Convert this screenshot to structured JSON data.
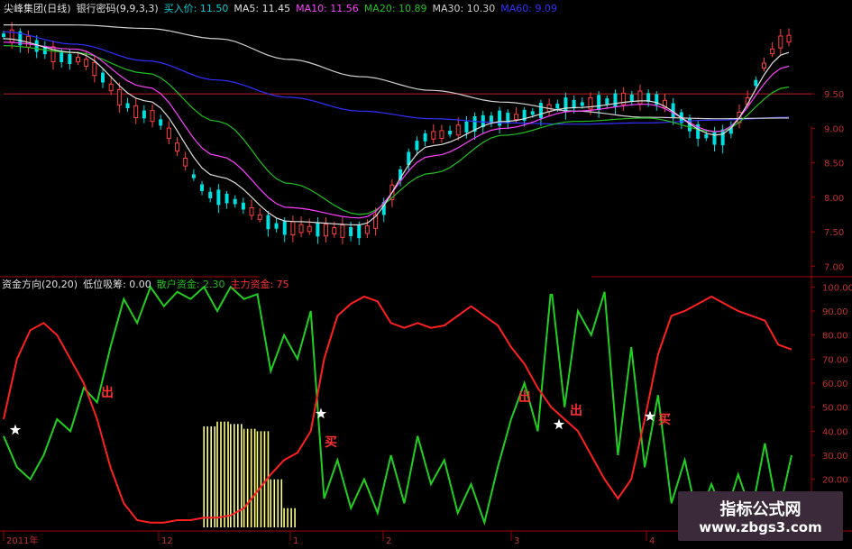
{
  "header_top": {
    "title": "尖峰集团(日线)",
    "indicator": "银行密码(9,9,3,3)",
    "items": [
      {
        "label": "买入价: 11.50",
        "color": "#00d0d0"
      },
      {
        "label": "MA5: 11.45",
        "color": "#e0e0e0"
      },
      {
        "label": "MA10: 11.56",
        "color": "#ff40ff"
      },
      {
        "label": "MA20: 10.89",
        "color": "#20c020"
      },
      {
        "label": "MA30: 10.30",
        "color": "#d0d0d0"
      },
      {
        "label": "MA60: 9.09",
        "color": "#3030ff"
      }
    ]
  },
  "header_bottom": {
    "title": "资金方向(20,20)",
    "items": [
      {
        "label": "低位吸筹: 0.00",
        "color": "#e0e0e0"
      },
      {
        "label": "散户资金: 2.30",
        "color": "#20c020"
      },
      {
        "label": "主力资金: 75",
        "color": "#ff3030"
      }
    ]
  },
  "x_labels": [
    "2011年",
    "12",
    "1",
    "2",
    "3",
    "4"
  ],
  "watermark": {
    "title": "指标公式网",
    "url": "www.zbgs3.com"
  },
  "annotations": [
    "出",
    "买",
    "出",
    "出",
    "买"
  ],
  "chart_data": [
    {
      "type": "line",
      "panel": "price",
      "y_ticks": [
        9.5,
        9.0,
        8.5,
        8.0,
        7.5,
        7.0
      ],
      "ylim": [
        6.9,
        10.6
      ],
      "reference_line": 9.5,
      "n_points": 96,
      "series": [
        {
          "name": "MA60",
          "color": "#3030ff",
          "values": [
            10.4,
            10.22,
            9.98,
            9.7,
            9.45,
            9.25,
            9.14,
            9.08,
            9.06,
            9.08,
            9.12,
            9.16
          ]
        },
        {
          "name": "MA30",
          "color": "#d0d0d0",
          "values": [
            10.5,
            10.5,
            10.45,
            10.3,
            10.0,
            9.75,
            9.55,
            9.38,
            9.25,
            9.16,
            9.14,
            9.15
          ]
        },
        {
          "name": "MA20",
          "color": "#20c020",
          "values": [
            10.2,
            10.1,
            9.8,
            9.1,
            8.2,
            7.75,
            8.35,
            8.9,
            9.1,
            9.15,
            8.95,
            9.6
          ]
        },
        {
          "name": "MA10",
          "color": "#ff40ff",
          "values": [
            10.25,
            10.15,
            9.6,
            8.6,
            7.85,
            7.7,
            8.6,
            9.0,
            9.25,
            9.35,
            8.95,
            9.9
          ]
        },
        {
          "name": "MA5",
          "color": "#e0e0e0",
          "values": [
            10.3,
            10.1,
            9.4,
            8.3,
            7.65,
            7.6,
            8.75,
            9.1,
            9.3,
            9.4,
            8.9,
            10.1
          ]
        },
        {
          "name": "买入价",
          "color": "#00d0d0",
          "values": [
            10.35,
            10.0,
            9.2,
            8.0,
            7.55,
            7.5,
            8.9,
            9.15,
            9.35,
            9.45,
            8.85,
            10.3
          ]
        }
      ]
    },
    {
      "type": "line",
      "panel": "fund",
      "y_ticks": [
        100,
        90,
        80,
        70,
        60,
        50,
        40,
        30,
        20
      ],
      "ylim": [
        0,
        102
      ],
      "series": [
        {
          "name": "主力资金",
          "color": "#ff2020",
          "values": [
            45,
            70,
            82,
            85,
            80,
            70,
            60,
            45,
            25,
            10,
            3,
            2,
            2,
            3,
            3,
            4,
            4,
            5,
            8,
            15,
            22,
            28,
            31,
            40,
            70,
            88,
            93,
            96,
            94,
            85,
            83,
            85,
            83,
            84,
            88,
            92,
            88,
            84,
            75,
            68,
            58,
            50,
            45,
            40,
            30,
            20,
            12,
            20,
            45,
            72,
            88,
            90,
            93,
            96,
            93,
            90,
            88,
            86,
            76,
            74
          ]
        },
        {
          "name": "散户资金",
          "color": "#20d020",
          "values": [
            38,
            25,
            20,
            30,
            45,
            40,
            58,
            52,
            75,
            95,
            85,
            100,
            92,
            98,
            95,
            100,
            90,
            100,
            95,
            97,
            65,
            80,
            70,
            90,
            12,
            28,
            8,
            20,
            6,
            30,
            10,
            38,
            18,
            28,
            6,
            18,
            2,
            25,
            45,
            60,
            40,
            100,
            50,
            90,
            80,
            98,
            30,
            75,
            25,
            55,
            10,
            28,
            3,
            18,
            4,
            22,
            6,
            35,
            5,
            30
          ]
        },
        {
          "name": "低位吸筹",
          "color": "#ffff80",
          "values": [
            0,
            0,
            0,
            0,
            0,
            0,
            0,
            0,
            0,
            0,
            0,
            0,
            0,
            0,
            0,
            42,
            44,
            43,
            41,
            40,
            20,
            8,
            0,
            0,
            0,
            0,
            0,
            0,
            0,
            0,
            0,
            0,
            0,
            0,
            0,
            0,
            0,
            0,
            0,
            0,
            0,
            0,
            0,
            0,
            0,
            0,
            0,
            0,
            0,
            0,
            0,
            0,
            0,
            0,
            0,
            0,
            0,
            0,
            0,
            0
          ]
        }
      ]
    }
  ]
}
